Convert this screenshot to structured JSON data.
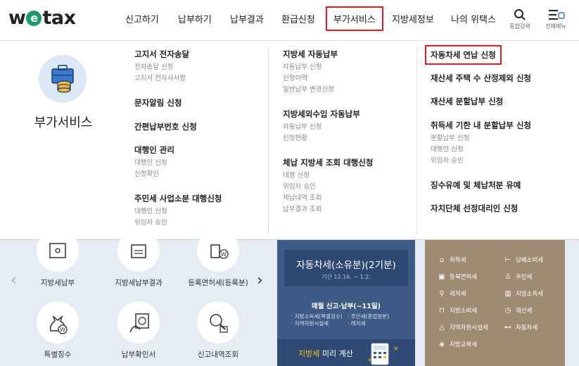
{
  "header": {
    "logo_pre": "w",
    "logo_e": "e",
    "logo_post": "tax",
    "nav": [
      "신고하기",
      "납부하기",
      "납부결과",
      "환급신청",
      "부가서비스",
      "지방세정보",
      "나의 위택스"
    ],
    "active_nav": "부가서비스",
    "tools": {
      "search_label": "통합검색",
      "menu_label": "전체메뉴"
    }
  },
  "dropdown": {
    "section_title": "부가서비스",
    "col1": [
      {
        "title": "고지서 전자송달",
        "subs": [
          "전자송달 신청",
          "고지서 전자사서함"
        ]
      },
      {
        "title": "문자알림 신청",
        "subs": []
      },
      {
        "title": "간편납부번호 신청",
        "subs": []
      },
      {
        "title": "대행인 관리",
        "subs": [
          "대행인 신청",
          "신청확인"
        ]
      },
      {
        "title": "주민세 사업소분 대행신청",
        "subs": [
          "대행인 신청",
          "위임자 승인"
        ]
      }
    ],
    "col2": [
      {
        "title": "지방세 자동납부",
        "subs": [
          "자동납부 신청",
          "신청이력",
          "일반납부 변경신청"
        ]
      },
      {
        "title": "지방세외수입 자동납부",
        "subs": [
          "자동납부 신청",
          "신청현황"
        ]
      },
      {
        "title": "체납 지방세 조회 대행신청",
        "subs": [
          "대행 신청",
          "위임자 승인",
          "체납내역 조회",
          "납부결과 조회"
        ]
      }
    ],
    "col3": [
      {
        "title": "자동차세 연납 신청",
        "subs": [],
        "highlight": true
      },
      {
        "title": "재산세 주택 수 산정제외 신청",
        "subs": []
      },
      {
        "title": "재산세 분할납부 신청",
        "subs": []
      },
      {
        "title": "취득세 기한 내 분할납부 신청",
        "subs": [
          "분할납부 신청",
          "대행인 신청",
          "위임자 승인"
        ]
      },
      {
        "title": "징수유예 및 체납처분 유예",
        "subs": []
      },
      {
        "title": "자치단체 선정대리인 신청",
        "subs": []
      }
    ]
  },
  "quick": {
    "row1": [
      "지방세납부",
      "지방세납부결과",
      "등록면허세(등록분)"
    ],
    "row2": [
      "특별징수",
      "납부확인서",
      "신고내역조회"
    ]
  },
  "promo": {
    "title": "자동차세(소유분)(2기분)",
    "period": "기간 12.16. ~ 1.2.",
    "monthly_head": "매월 신고·납부(~11일)",
    "list_left": [
      "· 지방소득세(특별징수)",
      "· 지역자원시설세"
    ],
    "list_right": [
      "· 주민세(종업원분)",
      "· 레저세"
    ],
    "bottom_highlight": "지방세",
    "bottom_text": " 미리 계산"
  },
  "taxes": {
    "left": [
      "취득세",
      "등록면허세",
      "레저세",
      "지방소비세",
      "지역자원시설세",
      "지방교육세"
    ],
    "right": [
      "담배소비세",
      "주민세",
      "지방소득세",
      "재산세",
      "자동차세"
    ]
  },
  "colors": {
    "accent_red": "#e51c23",
    "promo_blue": "#3e5a86",
    "tax_brown": "#9f8a72",
    "lower_bg": "#e5ecf4"
  }
}
